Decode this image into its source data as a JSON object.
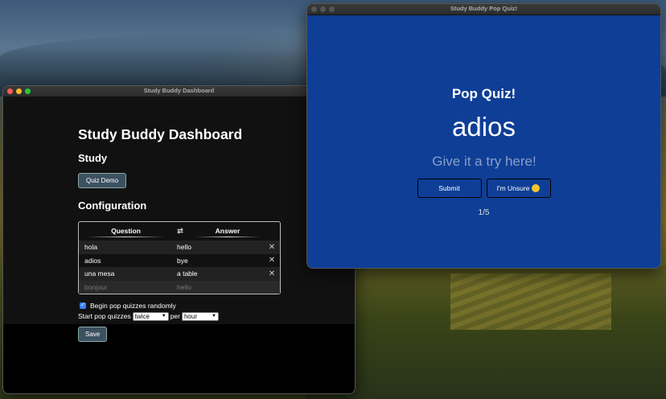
{
  "dashboard": {
    "window_title": "Study Buddy Dashboard",
    "heading": "Study Buddy Dashboard",
    "study_heading": "Study",
    "quiz_demo_label": "Quiz Demo",
    "config_heading": "Configuration",
    "table": {
      "question_header": "Question",
      "answer_header": "Answer",
      "swap_glyph": "⇄",
      "rows": [
        {
          "question": "hola",
          "answer": "hello"
        },
        {
          "question": "adios",
          "answer": "bye"
        },
        {
          "question": "una mesa",
          "answer": "a table"
        }
      ],
      "placeholder_question": "bonjour",
      "placeholder_answer": "hello",
      "delete_glyph": "✕"
    },
    "random_label": "Begin pop quizzes randomly",
    "start_label": "Start pop quizzes",
    "frequency_value": "twice",
    "per_label": "per",
    "period_value": "hour",
    "save_label": "Save"
  },
  "quiz": {
    "window_title": "Study Buddy Pop Quiz!",
    "heading": "Pop Quiz!",
    "word": "adios",
    "input_placeholder": "Give it a try here!",
    "submit_label": "Submit",
    "unsure_label": "I'm Unsure",
    "progress": "1/5"
  },
  "colors": {
    "quiz_background": "#0e3e96",
    "button_accent": "#3c5160"
  }
}
